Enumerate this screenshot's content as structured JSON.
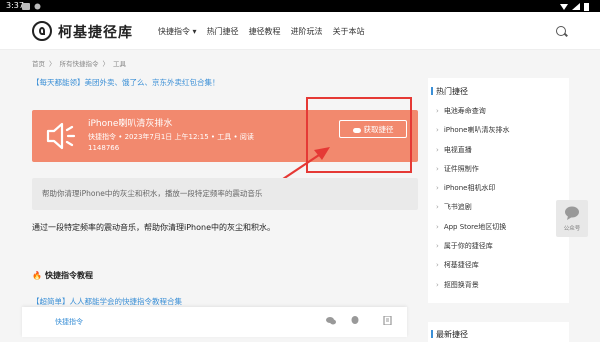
{
  "status": {
    "time": "3:37"
  },
  "header": {
    "site_title": "柯基捷径库",
    "nav": [
      "快捷指令 ▾",
      "热门捷径",
      "捷径教程",
      "进阶玩法",
      "关于本站"
    ]
  },
  "breadcrumb": [
    "首页",
    "〉",
    "所有快捷指令",
    "〉",
    "工具"
  ],
  "promo_text": "【每天都能领】美团外卖、饿了么、京东外卖红包合集！",
  "shortcut": {
    "title": "iPhone喇叭清灰排水",
    "meta_line1": "快捷指令 • 2023年7月1日 上午12:15 • 工具 • 阅读",
    "meta_line2": "1148766",
    "get_button": "获取捷径"
  },
  "description_box": "帮助你清理iPhone中的灰尘和积水，播放一段特定频率的震动音乐",
  "main_description": "通过一段特定频率的震动音乐，帮助你清理iPhone中的灰尘和积水。",
  "section": {
    "title": "快捷指令教程",
    "link": "【超简单】人人都能学会的快捷指令教程合集"
  },
  "bottom_bar": {
    "label": "快捷指令"
  },
  "sidebar": {
    "heading": "热门捷径",
    "items": [
      "电池寿命查询",
      "iPhone喇叭清灰排水",
      "电视直播",
      "证件照制作",
      "iPhone相机水印",
      "飞书追剧",
      "App Store地区切换",
      "属于你的捷径库",
      "柯基捷径库",
      "抠图换背景"
    ],
    "heading2": "最新捷径"
  },
  "wechat_float": {
    "label": "公众号"
  },
  "colors": {
    "card": "#f2896e",
    "accent": "#3a8fd6",
    "highlight": "#e53935"
  }
}
